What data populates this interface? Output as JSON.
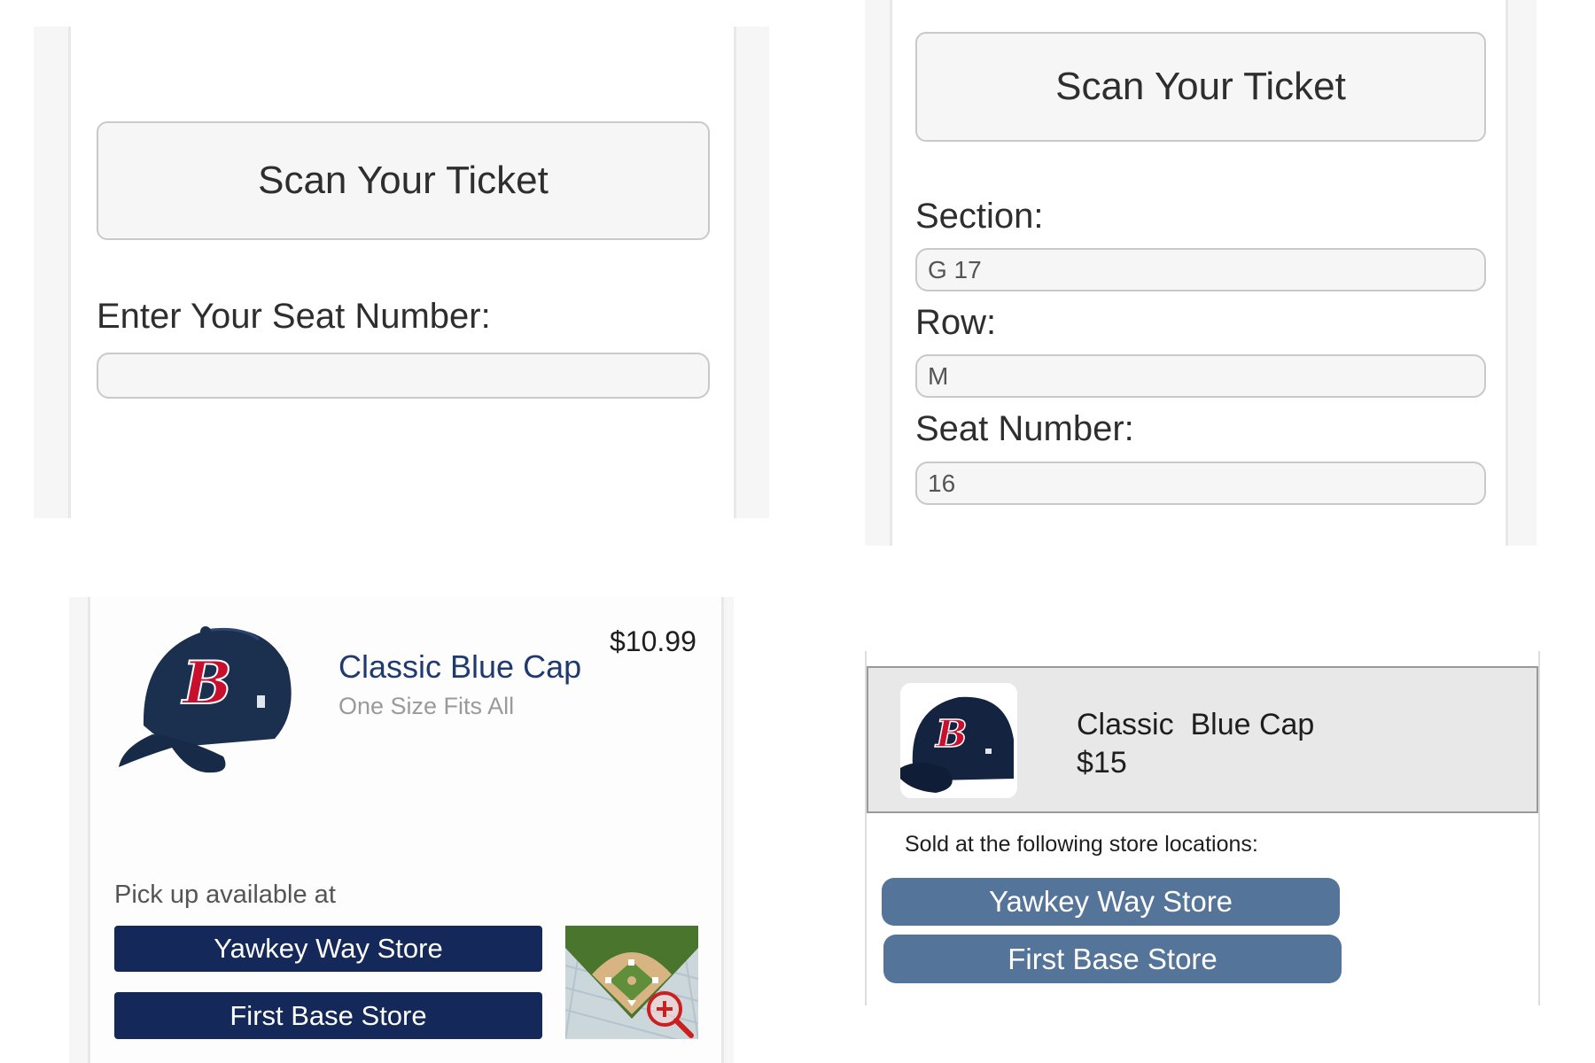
{
  "seat_entry": {
    "scan_label": "Scan Your Ticket",
    "seat_label": "Enter Your Seat Number:",
    "seat_value": ""
  },
  "scanned_ticket": {
    "scan_label": "Scan Your Ticket",
    "section_label": "Section:",
    "section_value": "G 17",
    "row_label": "Row:",
    "row_value": "M",
    "seat_label": "Seat Number:",
    "seat_value": "16"
  },
  "product_card_a": {
    "title": "Classic Blue Cap",
    "subtitle": "One Size Fits All",
    "price": "$10.99",
    "pickup_label": "Pick up available at",
    "stores": [
      "Yawkey Way Store",
      "First Base Store"
    ],
    "logo_letter": "B",
    "accent_color": "#14295a"
  },
  "product_card_b": {
    "title": "Classic  Blue Cap",
    "price": "$15",
    "sold_label": "Sold at the following store locations:",
    "stores": [
      "Yawkey Way Store",
      "First Base Store"
    ],
    "logo_letter": "B",
    "accent_color": "#557499"
  },
  "icons": {
    "cap": "baseball-cap-icon",
    "map": "ballpark-map-icon",
    "zoom": "zoom-in-icon"
  }
}
